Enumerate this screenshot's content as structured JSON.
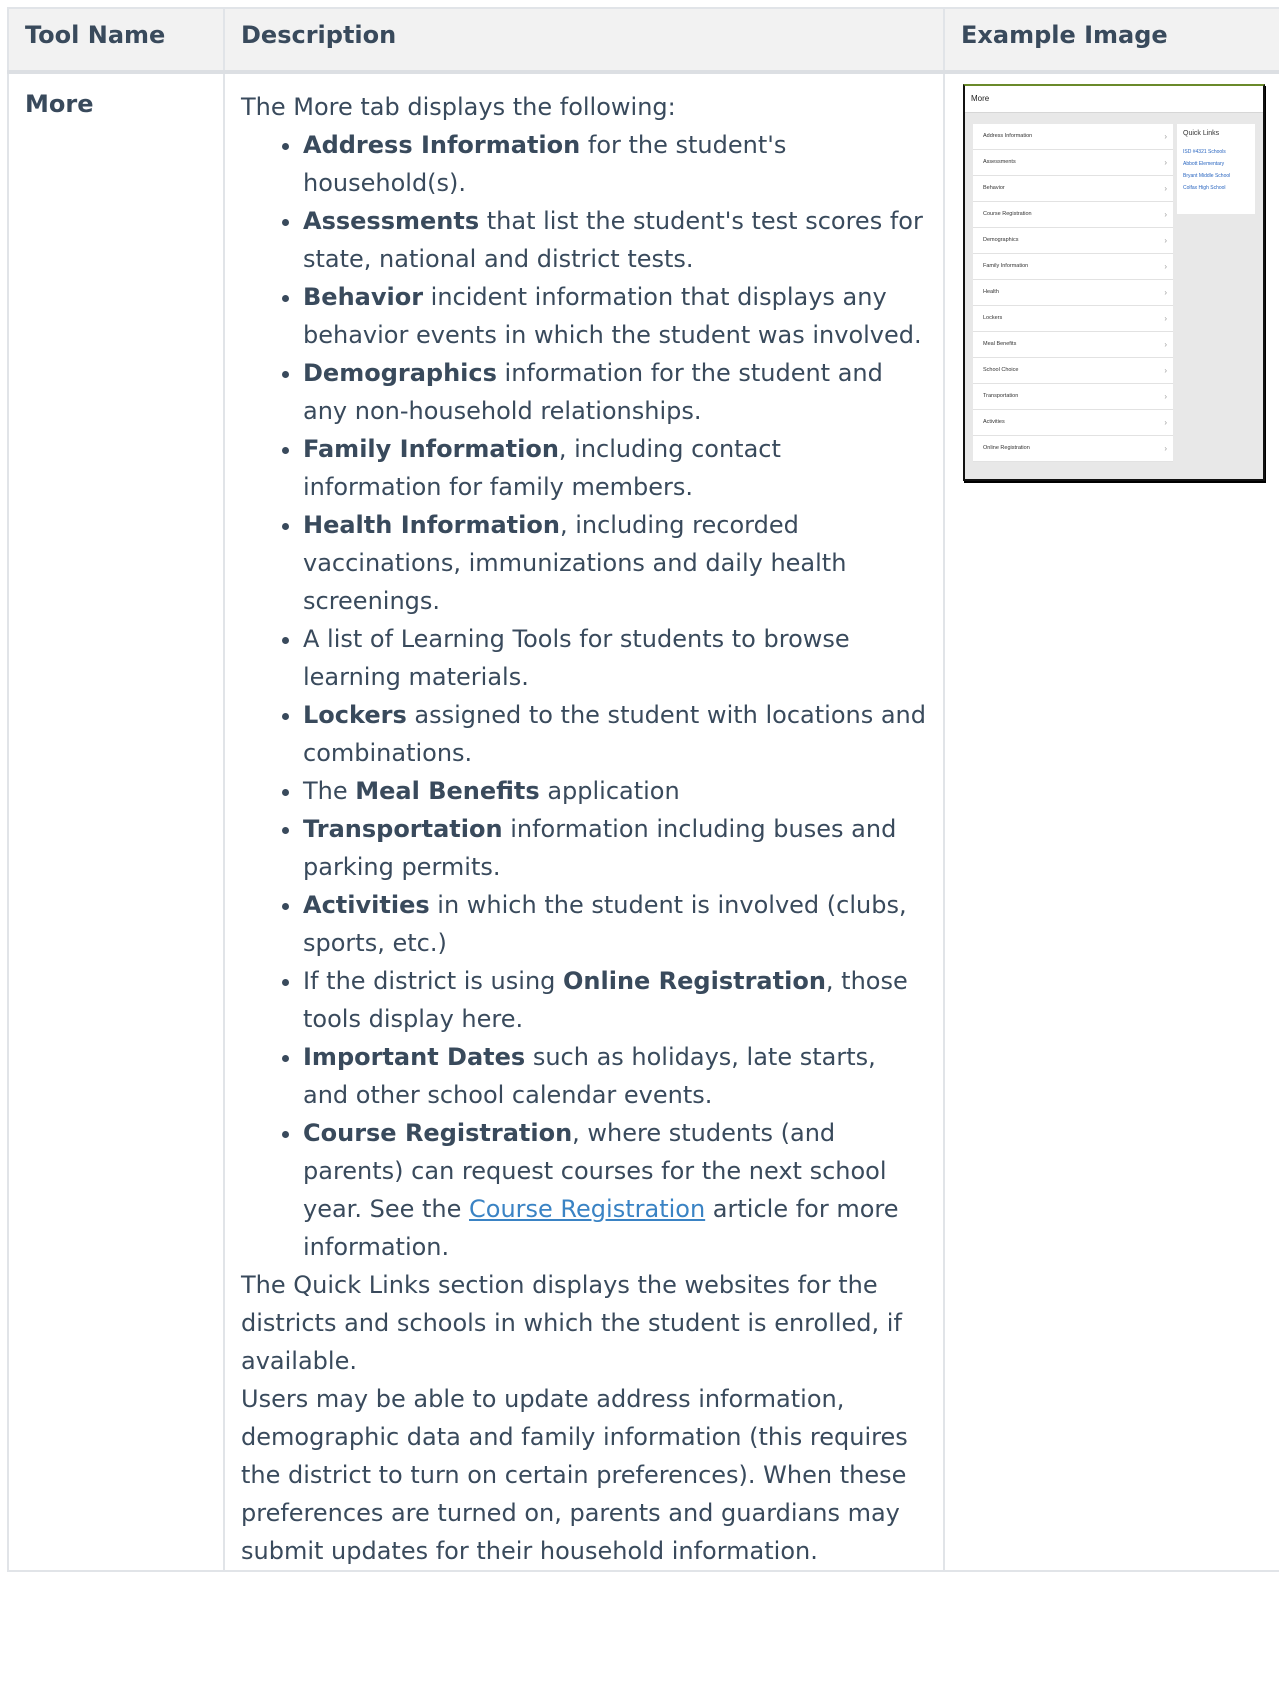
{
  "table": {
    "headers": [
      "Tool Name",
      "Description",
      "Example Image"
    ],
    "tool_name": "More",
    "intro": "The More tab displays the following:",
    "features": [
      {
        "bold": "Address Information",
        "pre": "",
        "post": " for the student's household(s)."
      },
      {
        "bold": "Assessments",
        "pre": "",
        "post": " that list the student's test scores for state, national and district tests."
      },
      {
        "bold": "Behavior",
        "pre": "",
        "post": " incident information that displays any behavior events in which the student was involved."
      },
      {
        "bold": "Demographics",
        "pre": "",
        "post": " information for the student and any non-household relationships."
      },
      {
        "bold": "Family Information",
        "pre": "",
        "post": ", including contact information for family members."
      },
      {
        "bold": "Health Information",
        "pre": "",
        "post": ", including recorded vaccinations, immunizations and daily health screenings."
      },
      {
        "bold": "",
        "pre": "A list of Learning Tools for students to browse learning materials.",
        "post": ""
      },
      {
        "bold": "Lockers",
        "pre": "",
        "post": " assigned to the student with locations and combinations."
      },
      {
        "bold": "Meal Benefits",
        "pre": "The ",
        "post": " application"
      },
      {
        "bold": "Transportation",
        "pre": "",
        "post": " information including buses and parking permits."
      },
      {
        "bold": "Activities",
        "pre": "",
        "post": " in which the student is involved (clubs, sports, etc.)"
      },
      {
        "bold": "Online Registration",
        "pre": "If the district is using ",
        "post": ", those tools display here."
      },
      {
        "bold": "Important Dates",
        "pre": "",
        "post": " such as holidays, late starts, and other school calendar events."
      }
    ],
    "course_reg": {
      "bold": "Course Registration",
      "text1": ", where students (and parents) can request courses for the next school year. See the ",
      "link": "Course Registration",
      "text2": " article for more information."
    },
    "para_quick_links": "The Quick Links section displays the websites for the districts and schools in which the student is enrolled, if available.",
    "para_updates": "Users may be able to update address information, demographic data and family information (this requires the district to turn on certain preferences). When these preferences are turned on, parents and guardians may submit updates for their household information.",
    "colors": {
      "text": "#394a5c",
      "link": "#3a83c4",
      "header_bg": "#f2f2f2",
      "border": "#e1e4e8"
    }
  },
  "thumbnail": {
    "title": "More",
    "items": [
      "Address Information",
      "Assessments",
      "Behavior",
      "Course Registration",
      "Demographics",
      "Family Information",
      "Health",
      "Lockers",
      "Meal Benefits",
      "School Choice",
      "Transportation",
      "Activities",
      "Online Registration"
    ],
    "quick_links_title": "Quick Links",
    "quick_links": [
      "ISD #4321 Schools",
      "Abbott Elementary",
      "Bryant Middle School",
      "Colfax High School"
    ]
  }
}
